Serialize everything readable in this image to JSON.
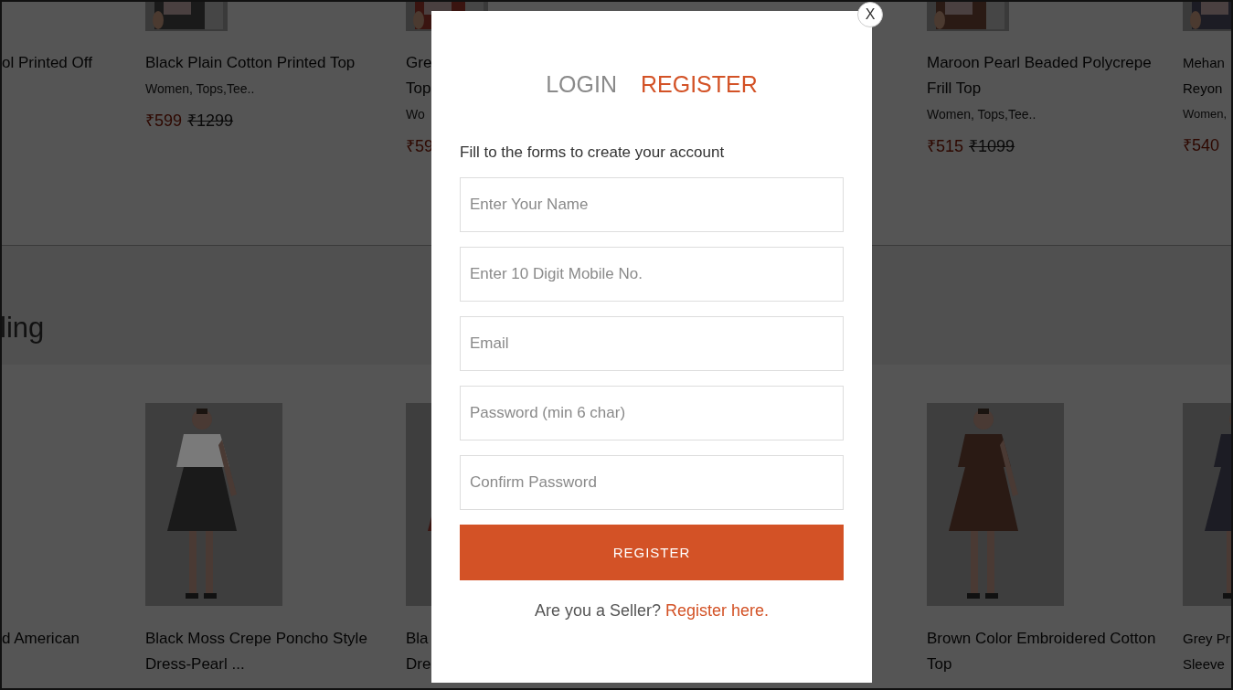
{
  "products_top": [
    {
      "title_lines": [
        "ol Printed Off"
      ]
    },
    {
      "image": {
        "kind": "picture"
      },
      "title_lines": [
        "Black Plain Cotton Printed Top"
      ],
      "category": "Women, Tops,Tee..",
      "price": "₹599",
      "old_price": "₹1299"
    },
    {
      "image": {
        "kind": "picture"
      },
      "title_lines": [
        "Gre",
        "Top"
      ],
      "category": "Wo",
      "price": "₹59"
    },
    {
      "image": {
        "kind": "picture"
      },
      "title_lines": [
        "Maroon Pearl Beaded Polycrepe",
        "Frill Top"
      ],
      "category": "Women, Tops,Tee..",
      "price": "₹515",
      "old_price": "₹1099"
    },
    {
      "image": {
        "kind": "picture"
      },
      "title_lines": [
        "Mehan",
        "Reyon"
      ],
      "category": "Women,",
      "price": "₹540"
    }
  ],
  "section_heading": "ling",
  "products_bottom": [
    {
      "title_lines": [
        "d American"
      ]
    },
    {
      "image": {
        "kind": "picture"
      },
      "title_lines": [
        "Black Moss Crepe Poncho Style",
        "Dress-Pearl ..."
      ]
    },
    {
      "image": {
        "kind": "picture"
      },
      "title_lines": [
        "Bla",
        "Dre"
      ]
    },
    {
      "image": {
        "kind": "picture"
      },
      "title_lines": [
        "Brown Color Embroidered Cotton",
        "Top"
      ]
    },
    {
      "image": {
        "kind": "picture"
      },
      "title_lines": [
        "Grey Pr",
        "Sleeve"
      ]
    }
  ],
  "modal": {
    "close": "X",
    "tabs": [
      {
        "label": "LOGIN",
        "selected": false
      },
      {
        "label": "REGISTER",
        "selected": true
      }
    ],
    "subtitle": "Fill to the forms to create your account",
    "fields": [
      {
        "placeholder": "Enter Your Name"
      },
      {
        "placeholder": "Enter 10 Digit Mobile No."
      },
      {
        "placeholder": "Email"
      },
      {
        "placeholder": "Password (min 6 char)"
      },
      {
        "placeholder": "Confirm Password"
      }
    ],
    "button": "REGISTER",
    "seller_prompt": "Are you a Seller?",
    "seller_link": "Register here."
  }
}
